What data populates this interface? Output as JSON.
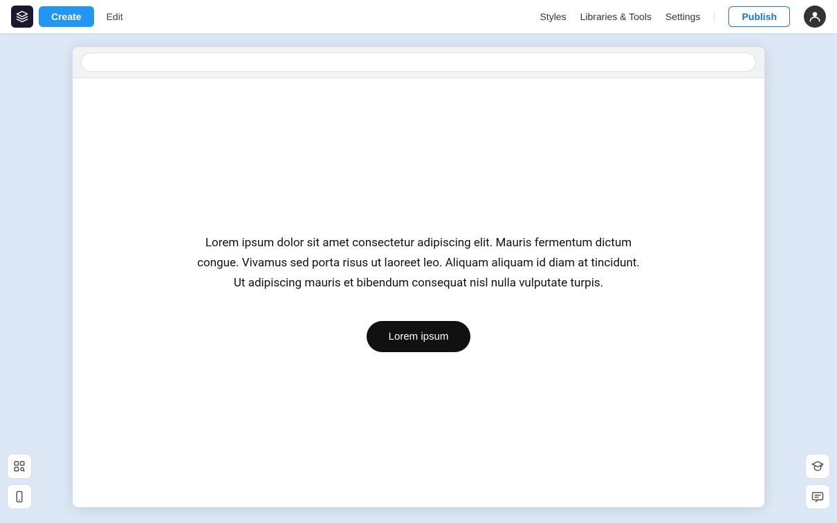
{
  "navbar": {
    "logo_symbol": "◈",
    "create_label": "Create",
    "edit_label": "Edit",
    "styles_label": "Styles",
    "libraries_tools_label": "Libraries & Tools",
    "settings_label": "Settings",
    "publish_label": "Publish"
  },
  "canvas": {
    "url_bar_value": "",
    "body_text": "Lorem ipsum dolor sit amet consectetur adipiscing elit. Mauris fermentum dictum congue. Vivamus sed porta risus ut laoreet leo. Aliquam aliquam id diam at tincidunt. Ut adipiscing mauris et bibendum consequat nisl nulla vulputate turpis.",
    "button_label": "Lorem ipsum"
  },
  "sidebar": {
    "search_zoom_icon": "🔍",
    "mobile_icon": "📱",
    "help_icon": "🎓",
    "chat_icon": "💬"
  }
}
